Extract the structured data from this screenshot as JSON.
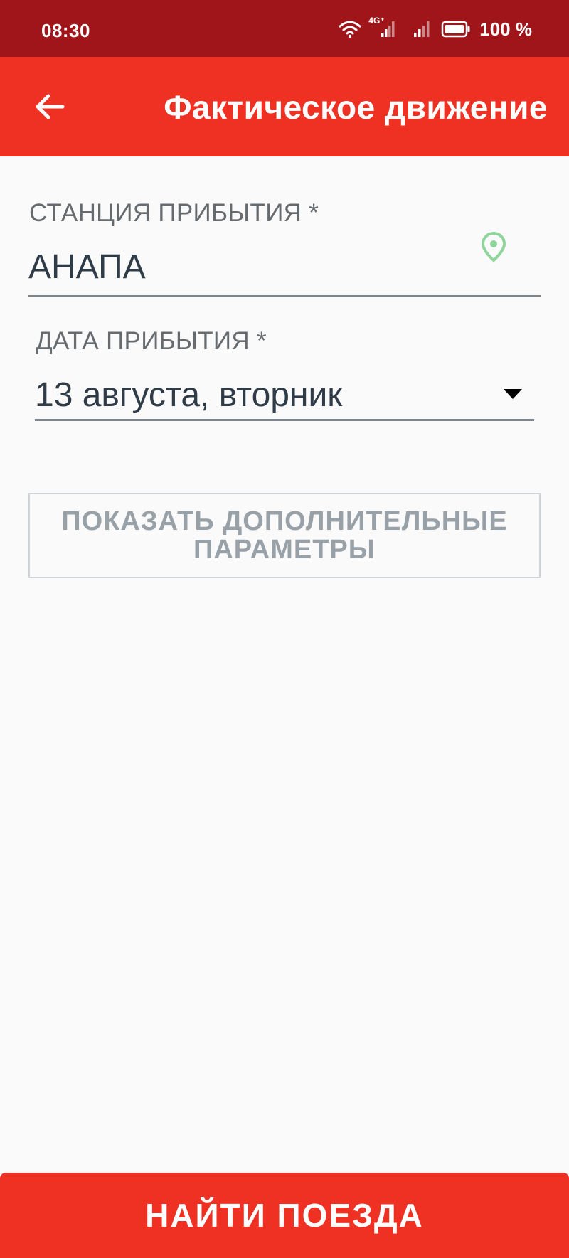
{
  "status_bar": {
    "time": "08:30",
    "network": "4G⁺",
    "battery": "100 %"
  },
  "header": {
    "title": "Фактическое движение",
    "back_icon": "arrow-left-icon"
  },
  "form": {
    "station": {
      "label": "СТАНЦИЯ ПРИБЫТИЯ *",
      "value": "АНАПА",
      "icon": "location-pin-icon"
    },
    "date": {
      "label": "ДАТА ПРИБЫТИЯ *",
      "value": "13 августа, вторник",
      "icon": "dropdown-arrow-icon"
    },
    "more_params_label": "ПОКАЗАТЬ ДОПОЛНИТЕЛЬНЫЕ ПАРАМЕТРЫ"
  },
  "footer": {
    "find_label": "НАЙТИ ПОЕЗДА"
  },
  "colors": {
    "status_bar": "#a0151a",
    "primary": "#ef3124",
    "pin": "#8fd49a"
  }
}
